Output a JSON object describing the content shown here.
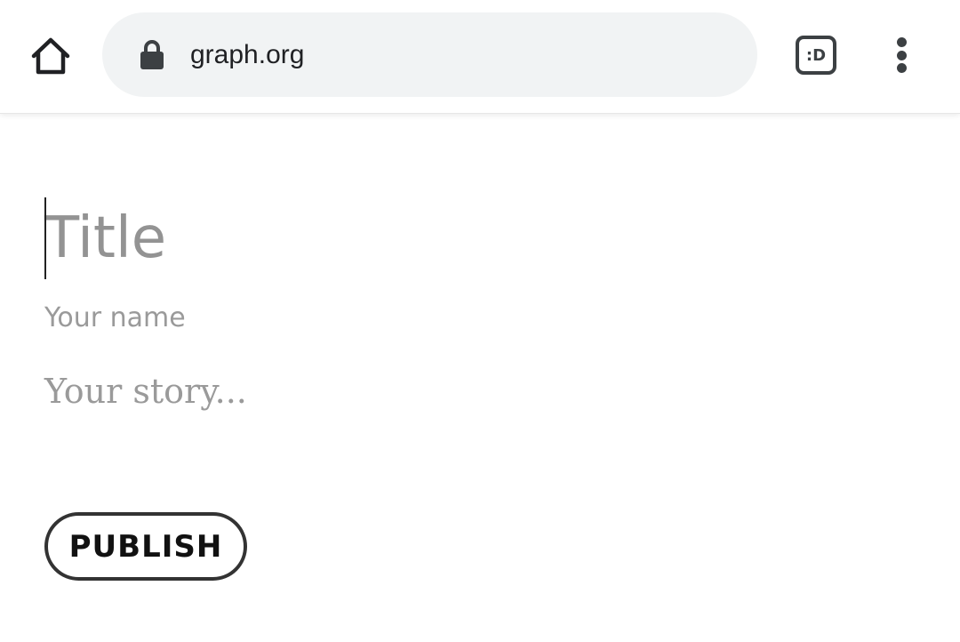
{
  "browser": {
    "url": "graph.org",
    "tabs_label": ":D",
    "icons": {
      "home": "home-icon",
      "lock": "lock-icon",
      "menu": "more-vert-icon"
    }
  },
  "editor": {
    "title_placeholder": "Title",
    "name_placeholder": "Your name",
    "story_placeholder": "Your story...",
    "publish_label": "PUBLISH"
  }
}
